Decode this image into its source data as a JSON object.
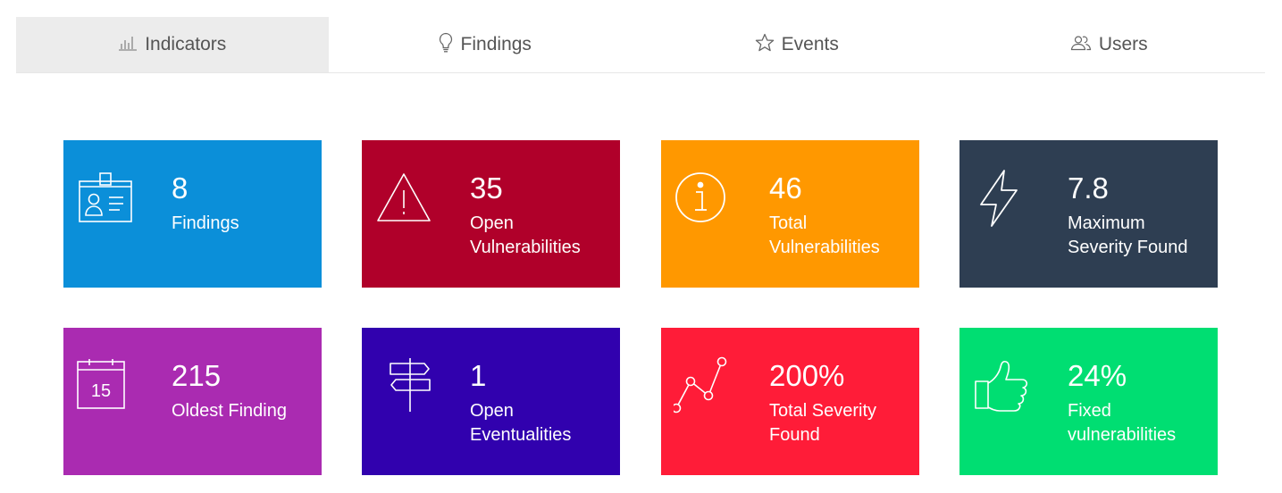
{
  "tabs": [
    {
      "label": "Indicators",
      "icon": "bar-chart-icon",
      "active": true
    },
    {
      "label": "Findings",
      "icon": "lightbulb-icon",
      "active": false
    },
    {
      "label": "Events",
      "icon": "star-icon",
      "active": false
    },
    {
      "label": "Users",
      "icon": "users-icon",
      "active": false
    }
  ],
  "cards": [
    {
      "value": "8",
      "label": "Findings",
      "color": "#0b8fd9",
      "icon": "id-badge-icon"
    },
    {
      "value": "35",
      "label": "Open Vulnerabilities",
      "color": "#b0002a",
      "icon": "warning-triangle-icon"
    },
    {
      "value": "46",
      "label": "Total Vulnerabilities",
      "color": "#ff9800",
      "icon": "info-circle-icon"
    },
    {
      "value": "7.8",
      "label": "Maximum Severity Found",
      "color": "#2e3e52",
      "icon": "lightning-bolt-icon"
    },
    {
      "value": "215",
      "label": "Oldest Finding",
      "color": "#aa2bb1",
      "icon": "calendar-icon"
    },
    {
      "value": "1",
      "label": "Open Eventualities",
      "color": "#3101ae",
      "icon": "signpost-icon"
    },
    {
      "value": "200%",
      "label": "Total Severity Found",
      "color": "#ff1c38",
      "icon": "line-graph-icon"
    },
    {
      "value": "24%",
      "label": "Fixed vulnerabilities",
      "color": "#00de72",
      "icon": "thumbs-up-icon"
    }
  ],
  "calendar_icon_text": "15"
}
